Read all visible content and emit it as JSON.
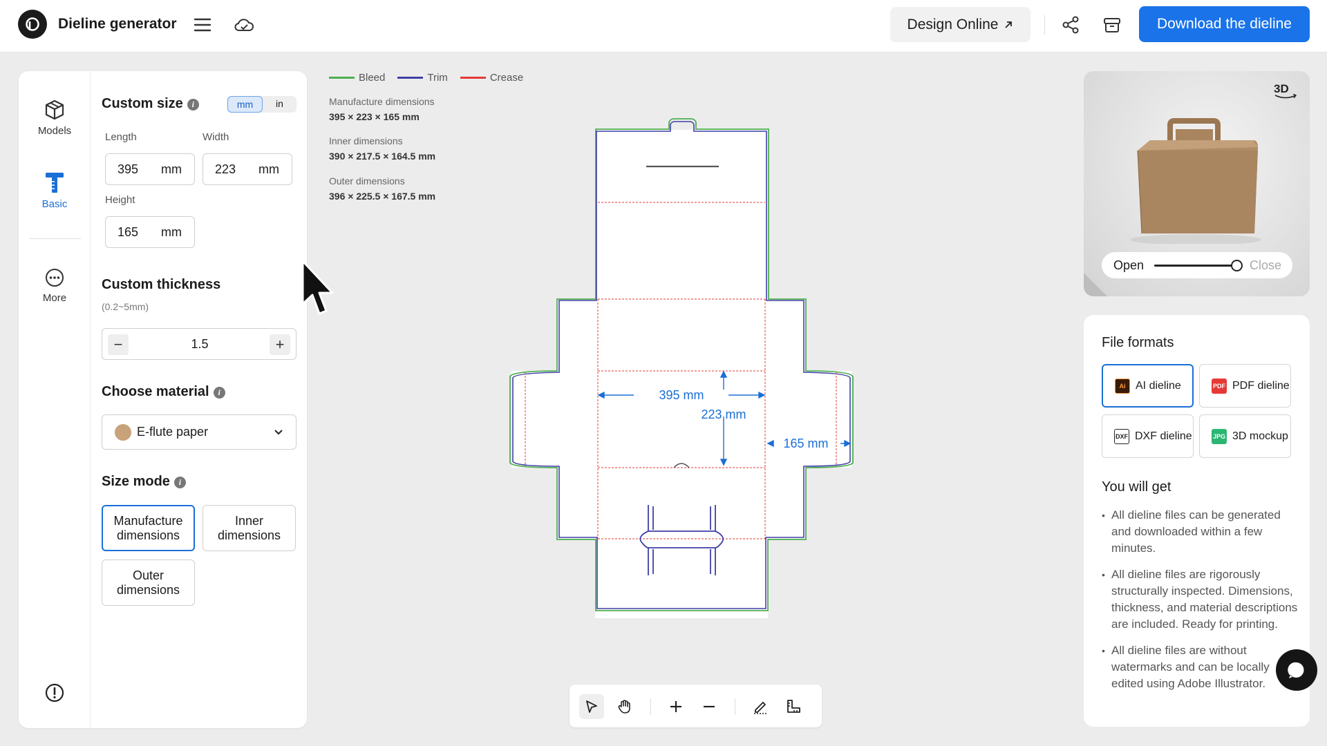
{
  "header": {
    "app_title": "Dieline generator",
    "design_online_label": "Design Online",
    "download_label": "Download the dieline"
  },
  "rail": {
    "models": "Models",
    "basic": "Basic",
    "more": "More"
  },
  "custom_size": {
    "title": "Custom size",
    "unit_mm": "mm",
    "unit_in": "in",
    "selected_unit": "mm",
    "length_label": "Length",
    "length_value": "395",
    "width_label": "Width",
    "width_value": "223",
    "height_label": "Height",
    "height_value": "165",
    "unit": "mm"
  },
  "thickness": {
    "title": "Custom thickness",
    "range": "(0.2~5mm)",
    "value": "1.5",
    "minus": "−",
    "plus": "+"
  },
  "material": {
    "title": "Choose material",
    "selected": "E-flute paper",
    "swatch_color": "#c8a27a"
  },
  "size_mode": {
    "title": "Size mode",
    "options": [
      "Manufacture dimensions",
      "Inner dimensions",
      "Outer dimensions"
    ],
    "selected": "Manufacture dimensions"
  },
  "legend": {
    "bleed": {
      "label": "Bleed",
      "color": "#4caf50"
    },
    "trim": {
      "label": "Trim",
      "color": "#3f3fa6"
    },
    "crease": {
      "label": "Crease",
      "color": "#e53935"
    }
  },
  "dimensions": {
    "manufacture_label": "Manufacture dimensions",
    "manufacture_value": "395 × 223 × 165 mm",
    "inner_label": "Inner dimensions",
    "inner_value": "390 × 217.5 × 164.5 mm",
    "outer_label": "Outer dimensions",
    "outer_value": "396 × 225.5 × 167.5 mm"
  },
  "dieline_labels": {
    "length": "395 mm",
    "width": "223 mm",
    "height": "165 mm"
  },
  "preview": {
    "badge": "3D",
    "open_label": "Open",
    "close_label": "Close",
    "open_state": 1.0
  },
  "file_formats": {
    "title": "File formats",
    "items": [
      {
        "label": "AI dieline",
        "icon": "ai-icon"
      },
      {
        "label": "PDF dieline",
        "icon": "pdf-icon"
      },
      {
        "label": "DXF dieline",
        "icon": "dxf-icon"
      },
      {
        "label": "3D mockup",
        "icon": "jpg-icon"
      }
    ],
    "selected": "AI dieline"
  },
  "you_will_get": {
    "title": "You will get",
    "items": [
      "All dieline files can be generated and downloaded within a few minutes.",
      "All dieline files are rigorously structurally inspected. Dimensions, thickness, and material descriptions are included. Ready for printing.",
      "All dieline files are without watermarks and can be locally edited using Adobe Illustrator."
    ]
  },
  "colors": {
    "accent": "#1a73e8",
    "dim_blue": "#1a6fd6"
  }
}
